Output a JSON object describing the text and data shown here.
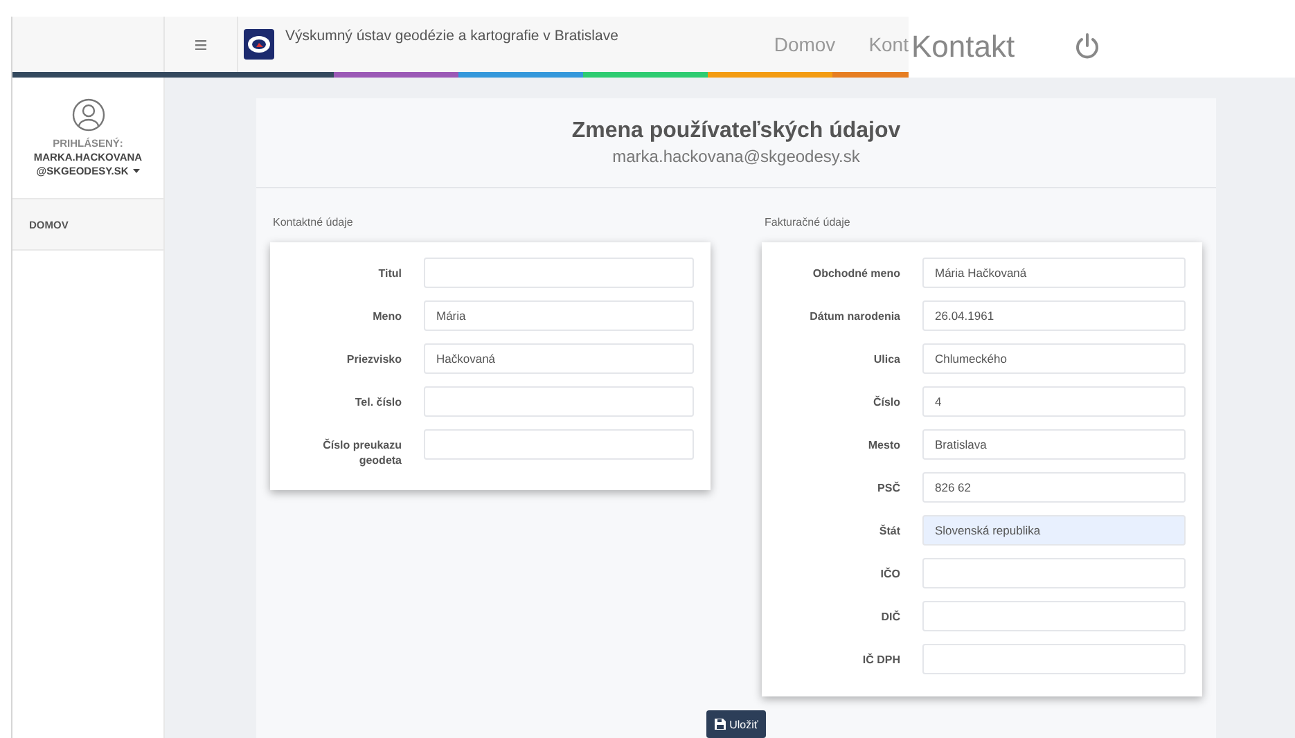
{
  "header": {
    "org_title": "Výskumný ústav geodézie a kartografie v Bratislave",
    "nav": [
      {
        "label": "Domov"
      },
      {
        "label": "Kont"
      }
    ],
    "overlay_label": "Kontakt"
  },
  "sidebar": {
    "user_caption": "PRIHLÁSENÝ:",
    "user_name": "MARKA.HACKOVANA",
    "user_domain": "@SKGEODESY.SK",
    "items": [
      {
        "label": "DOMOV",
        "selected": true
      }
    ]
  },
  "panel": {
    "title": "Zmena používateľských údajov",
    "subtitle": "marka.hackovana@skgeodesy.sk",
    "sections": [
      {
        "title": "Kontaktné údaje",
        "fields": [
          {
            "label": "Titul",
            "focused": false
          },
          {
            "label": "Meno",
            "value": "Mária",
            "focused": false
          },
          {
            "label": "Priezvisko",
            "value": "Hačkovaná",
            "focused": false
          },
          {
            "label": "Tel. číslo",
            "focused": false
          },
          {
            "label": "Číslo preukazu geodeta",
            "focused": false
          }
        ]
      },
      {
        "title": "Fakturačné údaje",
        "fields": [
          {
            "label": "Obchodné meno",
            "value": "Mária Hačkovaná",
            "focused": false
          },
          {
            "label": "Dátum narodenia",
            "value": "26.04.1961",
            "focused": false
          },
          {
            "label": "Ulica",
            "value": "Chlumeckého",
            "focused": false
          },
          {
            "label": "Číslo",
            "value": "4",
            "focused": false
          },
          {
            "label": "Mesto",
            "value": "Bratislava",
            "focused": false
          },
          {
            "label": "PSČ",
            "value": "826 62",
            "focused": false
          },
          {
            "label": "Štát",
            "value": "Slovenská republika",
            "focused": true
          },
          {
            "label": "IČO",
            "focused": false
          },
          {
            "label": "DIČ",
            "focused": false
          },
          {
            "label": "IČ DPH",
            "focused": false
          }
        ]
      }
    ],
    "save_button": "Uložiť"
  }
}
